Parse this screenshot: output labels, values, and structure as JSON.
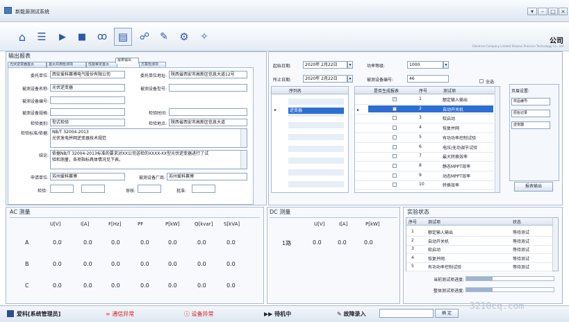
{
  "window": {
    "title": "新能源测试系统",
    "min": "–",
    "max": "□",
    "close": "×",
    "extra": "▾"
  },
  "toolbar": {
    "home": "⌂",
    "list": "☰",
    "play": "▶",
    "stop": "■",
    "binoculars": "ꝏ",
    "document": "▤",
    "users": "☍",
    "wrench": "✎",
    "gear": "⚙",
    "wand": "✧",
    "dd": "·"
  },
  "brand": {
    "name": "公司",
    "sub": "Electrical Company Limited Shaanxi Province Technology Co., Ltd"
  },
  "output": {
    "title": "输出报表",
    "tabs": [
      "光伏逆变器首页",
      "首页共用检测项",
      "性能审定首页",
      "报表输出",
      "方案检测项"
    ],
    "fields": {
      "client_label": "委托单位:",
      "client": "西安爱科赛博电气股份有限公司",
      "client_addr_label": "委托单位地址:",
      "client_addr": "陕西省西安市高新区信息大道12号",
      "device_name_label": "被测设备名称:",
      "device_name": "光伏逆变器",
      "device_model_label": "被测设备型号:",
      "device_model": "",
      "device_no_label": "被测设备编号:",
      "device_no": "",
      "device_spec_label": "被测设备规格:",
      "device_spec": "",
      "test_time_label": "检验时间:",
      "test_time": "",
      "test_type_label": "检验类别:",
      "test_type": "型式检验",
      "test_place_label": "检验地点:",
      "test_place": "陕西省西安市高新区信息大道",
      "standard_label": "检验标准/依据:",
      "standard_lines": [
        "NB/T 32004-2013",
        "光伏发电并网逆变器技术规范"
      ],
      "conclusion_label": "结论:",
      "conclusion_lines": [
        "依据NB/T 32004-2013标准的要求对XX公司送检的XXXX-XX型光伏逆变器进行了试",
        "验和测量，各项指标具体情况见下表。"
      ],
      "applicant_label": "申请单位:",
      "applicant": "苏州爱科赛博",
      "maker_label": "被测设备厂商:",
      "maker": "苏州爱科赛博",
      "inspector_label": "检验:",
      "reviewer_label": "审核:",
      "approver_label": "批准:"
    }
  },
  "dates": {
    "start_label": "起始日期:",
    "start": "2020年 2月22日",
    "end_label": "所止日期:",
    "end": "2020年 2月22日",
    "power_label": "功率等级:",
    "power": "1000",
    "dev_no_label": "被测设备编号:",
    "dev_no": "46",
    "select_all": "全选"
  },
  "seq_table": {
    "header": "序列名",
    "rows": [
      "",
      "逆变器",
      "",
      "",
      "",
      "",
      "",
      "",
      ""
    ]
  },
  "items_table": {
    "headers": [
      "是否生成报表",
      "序号",
      "测试项"
    ],
    "rows": [
      {
        "no": "1",
        "name": "额定输入输出"
      },
      {
        "no": "2",
        "name": "自动开关机"
      },
      {
        "no": "3",
        "name": "软启动"
      },
      {
        "no": "4",
        "name": "恢复并网"
      },
      {
        "no": "5",
        "name": "有功功率控制试验"
      },
      {
        "no": "6",
        "name": "电压/无功调节试验"
      },
      {
        "no": "7",
        "name": "最大转换效率"
      },
      {
        "no": "8",
        "name": "静态MPPT效率"
      },
      {
        "no": "9",
        "name": "动态MPPT效率"
      },
      {
        "no": "10",
        "name": "转换效率"
      }
    ]
  },
  "page_settings": {
    "title": "页眉设置:",
    "items": [
      "样品编号:",
      "原始记录",
      "逆变器"
    ],
    "export": "报表输出"
  },
  "ac": {
    "title": "AC 测量",
    "headers": [
      "U[V]",
      "I[A]",
      "F[Hz]",
      "PF",
      "P[kW]",
      "Q[kvar]",
      "S[kVA]"
    ],
    "rows": [
      {
        "name": "A",
        "values": [
          "0.0",
          "0.0",
          "0.0",
          "0.0",
          "0.0",
          "0.0",
          "0.0"
        ]
      },
      {
        "name": "B",
        "values": [
          "0.0",
          "0.0",
          "0.0",
          "0.0",
          "0.0",
          "0.0",
          "0.0"
        ]
      },
      {
        "name": "C",
        "values": [
          "0.0",
          "0.0",
          "0.0",
          "0.0",
          "0.0",
          "0.0",
          "0.0"
        ]
      }
    ]
  },
  "dc": {
    "title": "DC 测量",
    "headers": [
      "U[V]",
      "I[A]",
      "P[kW]"
    ],
    "rows": [
      {
        "name": "1路",
        "values": [
          "0.0",
          "0.0",
          "0.0"
        ]
      }
    ]
  },
  "exp": {
    "title": "实验状态",
    "headers": [
      "序号",
      "测试项",
      "状态"
    ],
    "rows": [
      {
        "no": "1",
        "name": "额定输入输出",
        "state": "等待测试"
      },
      {
        "no": "2",
        "name": "自动开关机",
        "state": "等待测试"
      },
      {
        "no": "3",
        "name": "软启动",
        "state": "等待测试"
      },
      {
        "no": "4",
        "name": "恢复并网",
        "state": "等待测试"
      },
      {
        "no": "5",
        "name": "有功功率控制试验",
        "state": "等待测试"
      }
    ],
    "cur_label": "当前测试项进度:",
    "total_label": "整体测试项进度:"
  },
  "status": {
    "user": "爱科[系统管理员]",
    "comm": "通信异常",
    "device": "设备异常",
    "mode": "待机中",
    "fault_label": "故障录入",
    "confirm": "确 定"
  },
  "watermark": "3210cq.com",
  "colors": {
    "accent": "#2d6ed3",
    "error": "#d42020"
  }
}
